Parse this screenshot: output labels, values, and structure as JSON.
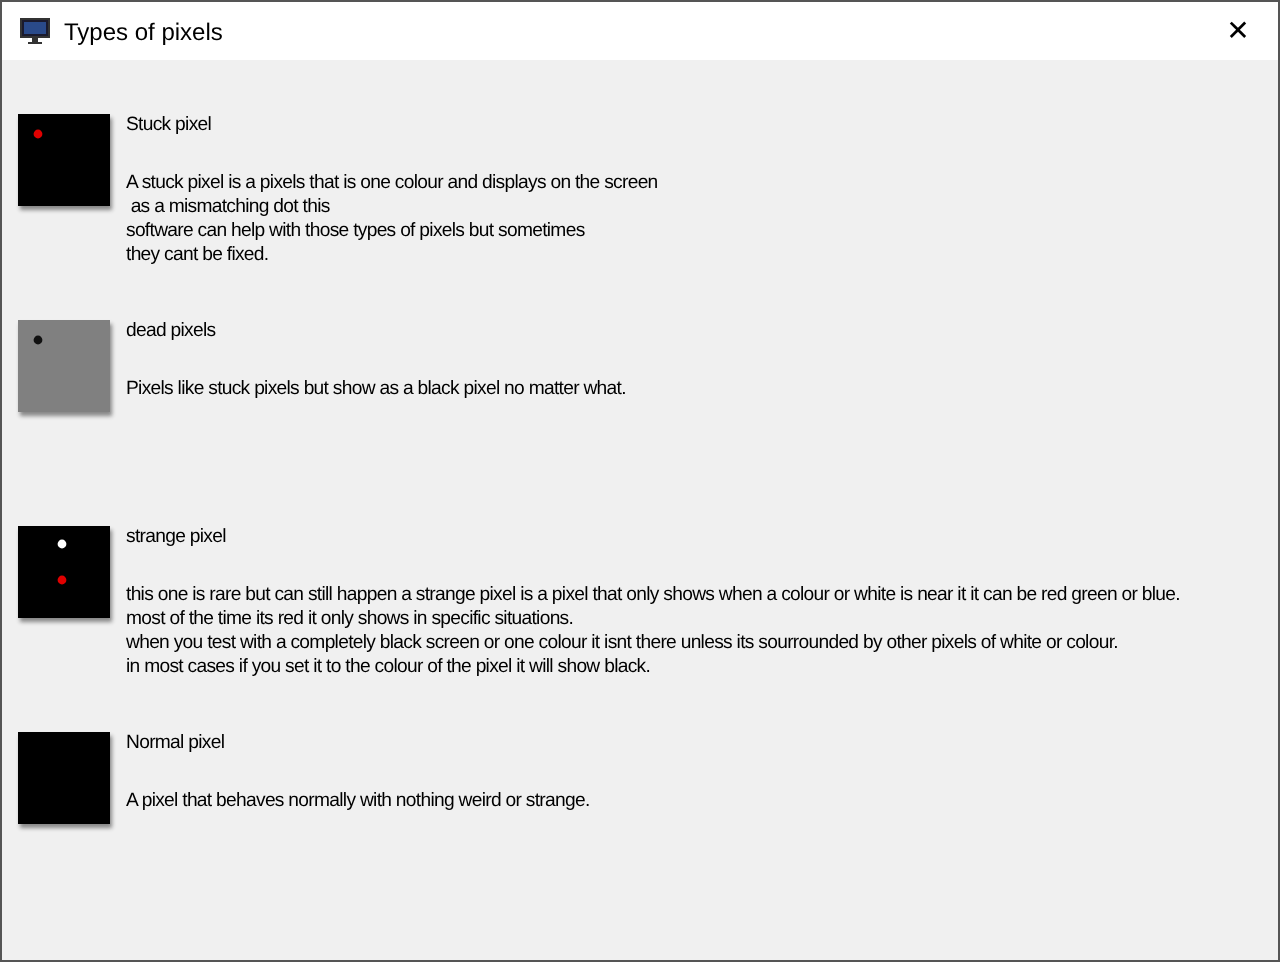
{
  "window": {
    "title": "Types of pixels",
    "close": "✕"
  },
  "sections": [
    {
      "kind": "stuck",
      "title": "Stuck pixel",
      "lines": [
        "A stuck pixel is a pixels that is one colour and displays on the screen",
        " as a mismatching dot this",
        "software can help with those types of pixels but sometimes",
        "they cant be fixed."
      ]
    },
    {
      "kind": "dead",
      "title": "dead pixels",
      "lines": [
        "Pixels like stuck pixels but show as a black pixel no matter what."
      ]
    },
    {
      "kind": "strange",
      "title": "strange pixel",
      "lines": [
        "this one is rare but can still happen a strange pixel is a pixel that only shows when a colour or white is near it it can be red green or blue.",
        "most of the time its red it only shows in specific situations.",
        "when you test with a completely black screen or one colour it isnt there unless its sourrounded by other pixels of white or colour.",
        "in most cases if you set it to the colour of the pixel it will show black."
      ]
    },
    {
      "kind": "normal",
      "title": "Normal pixel",
      "lines": [
        "A pixel that behaves normally with nothing weird or strange."
      ]
    }
  ]
}
